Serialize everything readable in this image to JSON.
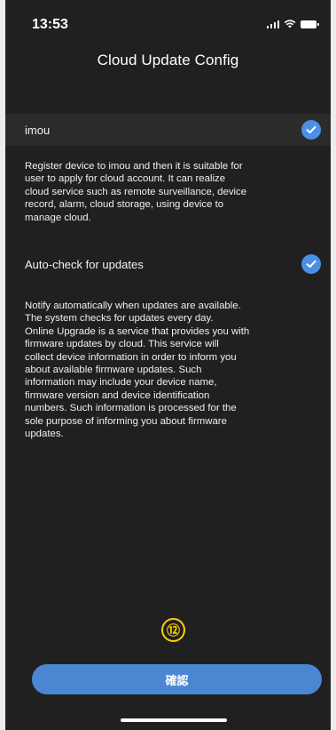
{
  "status_bar": {
    "time": "13:53"
  },
  "header": {
    "title": "Cloud Update Config"
  },
  "options": [
    {
      "label": "imou",
      "checked": true,
      "description": "Register device to imou and then it is suitable for\nuser to apply for cloud account. It can realize\ncloud service such as remote surveillance, device\nrecord, alarm, cloud storage, using device to\nmanage cloud."
    },
    {
      "label": "Auto-check for updates",
      "checked": true,
      "description": "Notify automatically when updates are available.\nThe system checks for updates every day.\nOnline Upgrade is a service that provides you with\nfirmware updates by cloud. This service will\ncollect device information in order to inform you\nabout available firmware updates. Such\ninformation may include your device name,\nfirmware version and device identification\nnumbers. Such information is processed for the\nsole purpose of informing you about firmware\nupdates."
    }
  ],
  "step_marker": "⑫",
  "confirm_button": {
    "label": "確認"
  },
  "colors": {
    "background": "#202020",
    "row_background": "#2b2b2b",
    "accent": "#4a86d2",
    "check": "#4b8fe6",
    "marker": "#ffd000"
  }
}
